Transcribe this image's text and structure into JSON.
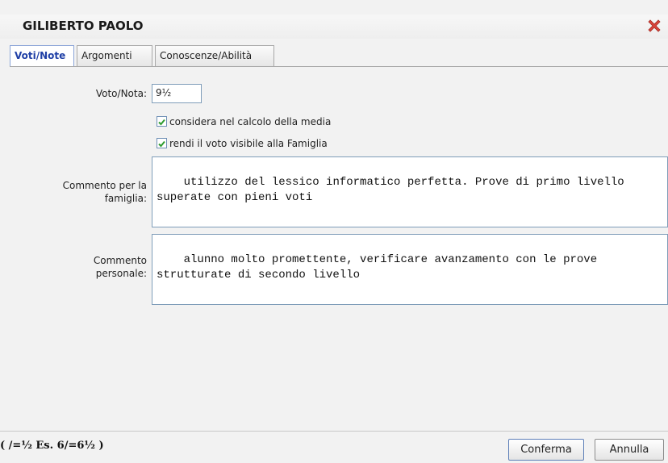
{
  "dialog": {
    "title": "GILIBERTO PAOLO",
    "close_icon": "close-x-icon"
  },
  "tabs": [
    {
      "label": "Voti/Note",
      "active": true
    },
    {
      "label": "Argomenti",
      "active": false
    },
    {
      "label": "Conoscenze/Abilità",
      "active": false
    }
  ],
  "form": {
    "voto_label": "Voto/Nota:",
    "voto_value": "9½",
    "media_checkbox": {
      "label": "considera nel calcolo della media",
      "checked": true
    },
    "famiglia_checkbox": {
      "label": "rendi il voto visibile alla Famiglia",
      "checked": true
    },
    "commento_famiglia_label_1": "Commento per la",
    "commento_famiglia_label_2": "famiglia:",
    "commento_famiglia_value": "utilizzo del lessico informatico perfetta. Prove di primo livello superate con pieni voti",
    "commento_personale_label_1": "Commento",
    "commento_personale_label_2": "personale:",
    "commento_personale_value": "alunno molto promettente, verificare avanzamento con le prove strutturate di secondo livello"
  },
  "footer": {
    "hint": "( /=½ Es. 6/=6½ )",
    "confirm_label": "Conferma",
    "cancel_label": "Annulla"
  },
  "colors": {
    "active_tab_text": "#1f3fa6",
    "close_icon": "#d9453b",
    "checkmark": "#2e9b2e"
  }
}
